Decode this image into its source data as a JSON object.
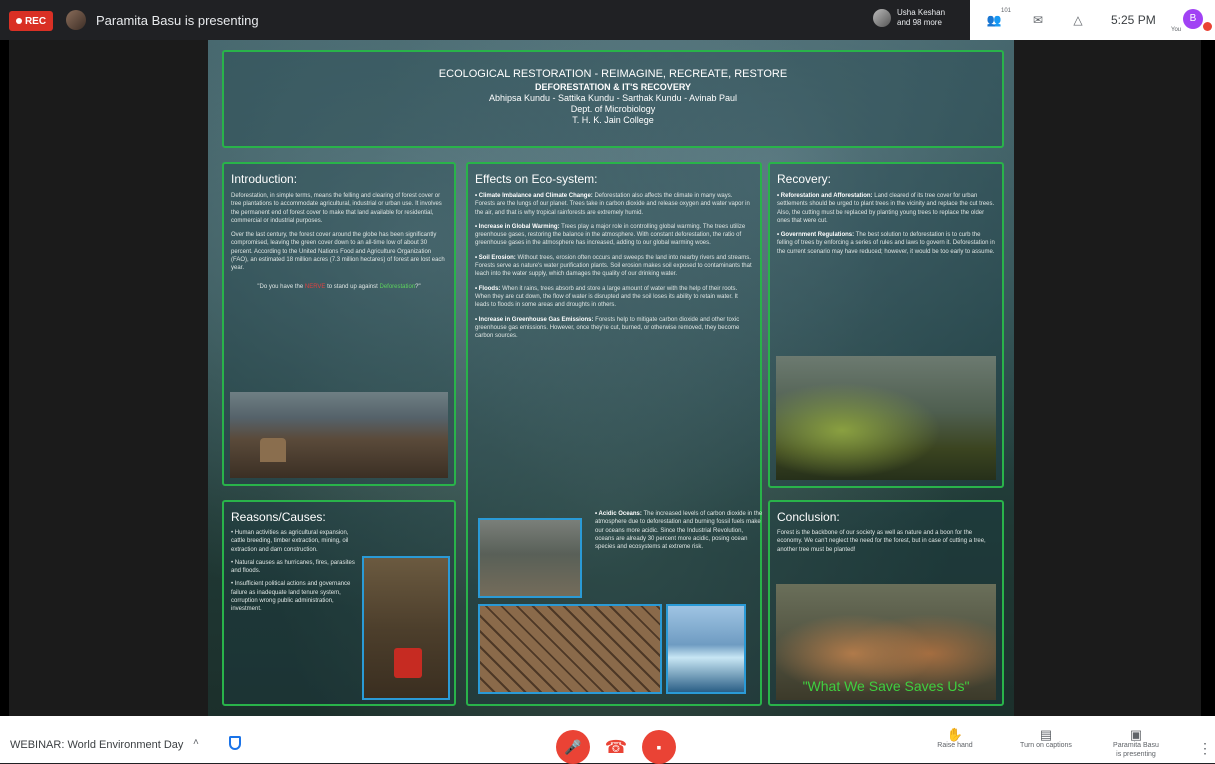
{
  "topbar": {
    "rec_label": "REC",
    "presenter_text": "Paramita Basu is presenting",
    "participants_line1": "Usha Keshan",
    "participants_line2": "and 98 more",
    "people_badge": "101",
    "time": "5:25 PM",
    "you_label": "You",
    "you_initial": "B"
  },
  "poster": {
    "header": {
      "line1": "ECOLOGICAL RESTORATION - REIMAGINE, RECREATE, RESTORE",
      "line2": "DEFORESTATION & IT'S RECOVERY",
      "authors": "Abhipsa Kundu - Sattika Kundu - Sarthak Kundu - Avinab Paul",
      "dept": "Dept. of Microbiology",
      "college": "T. H. K. Jain College"
    },
    "introduction": {
      "title": "Introduction:",
      "p1": "Deforestation, in simple terms, means the felling and clearing of forest cover or tree plantations to accommodate agricultural, industrial or urban use. It involves the permanent end of forest cover to make that land available for residential, commercial or industrial purposes.",
      "p2": "Over the last century, the forest cover around the globe has been significantly compromised, leaving the green cover down to an all-time low of about 30 percent. According to the United Nations Food and Agriculture Organization (FAO), an estimated 18 million acres (7.3 million hectares) of forest are lost each year.",
      "quote_a": "\"Do you have the ",
      "quote_red": "NERVE",
      "quote_b": " to stand up against ",
      "quote_green": "Deforestation",
      "quote_c": "?\""
    },
    "effects": {
      "title": "Effects on Eco-system:",
      "e1_head": "• Climate Imbalance and Climate Change:",
      "e1_body": " Deforestation also affects the climate in many ways. Forests are the lungs of our planet. Trees take in carbon dioxide and release oxygen and water vapor in the air, and that is why tropical rainforests are extremely humid.",
      "e2_head": "• Increase in Global Warming:",
      "e2_body": " Trees play a major role in controlling global warming. The trees utilize greenhouse gases, restoring the balance in the atmosphere. With constant deforestation, the ratio of greenhouse gases in the atmosphere has increased, adding to our global warming woes.",
      "e3_head": "• Soil Erosion:",
      "e3_body": " Without trees, erosion often occurs and sweeps the land into nearby rivers and streams. Forests serve as nature's water purification plants. Soil erosion makes soil exposed to contaminants that leach into the water supply, which damages the quality of our drinking water.",
      "e4_head": "• Floods:",
      "e4_body": " When it rains, trees absorb and store a large amount of water with the help of their roots. When they are cut down, the flow of water is disrupted and the soil loses its ability to retain water. It leads to floods in some areas and droughts in others.",
      "e5_head": "• Increase in Greenhouse Gas Emissions:",
      "e5_body": " Forests help to mitigate carbon dioxide and other toxic greenhouse gas emissions. However, once they're cut, burned, or otherwise removed, they become carbon sources.",
      "e6_head": "• Acidic Oceans:",
      "e6_body": " The increased levels of carbon dioxide in the atmosphere due to deforestation and burning fossil fuels make our oceans more acidic. Since the Industrial Revolution, oceans are already 30 percent more acidic, posing ocean species and ecosystems at extreme risk."
    },
    "recovery": {
      "title": "Recovery:",
      "r1_head": "• Reforestation and Afforestation:",
      "r1_body": " Land cleared of its tree cover for urban settlements should be urged to plant trees in the vicinity and replace the cut trees. Also, the cutting must be replaced by planting young trees to replace the older ones that were cut.",
      "r2_head": "• Government Regulations:",
      "r2_body": " The best solution to deforestation is to curb the felling of trees by enforcing a series of rules and laws to govern it. Deforestation in the current scenario may have reduced; however, it would be too early to assume."
    },
    "reasons": {
      "title": "Reasons/Causes:",
      "c1": "• Human activities as agricultural expansion, cattle breeding, timber extraction, mining, oil extraction and dam construction.",
      "c2": "• Natural causes as hurricanes, fires, parasites and floods.",
      "c3": "• Insufficient political actions and governance failure as inadequate land tenure system, corruption wrong public administration, investment."
    },
    "conclusion": {
      "title": "Conclusion:",
      "body": "Forest is the backbone of our society as well as nature and a boon for the economy. We can't neglect the need for the forest, but in case of cutting a tree, another tree must be planted!",
      "motto": "\"What We Save Saves Us\""
    }
  },
  "bottombar": {
    "meeting_title": "WEBINAR: World Environment Day",
    "raise_hand": "Raise hand",
    "captions": "Turn on captions",
    "presenting_line1": "Paramita Basu",
    "presenting_line2": "is presenting"
  },
  "colors": {
    "record_red": "#d93025",
    "poster_border_green": "#29b34a",
    "end_call_red": "#ea4335"
  }
}
